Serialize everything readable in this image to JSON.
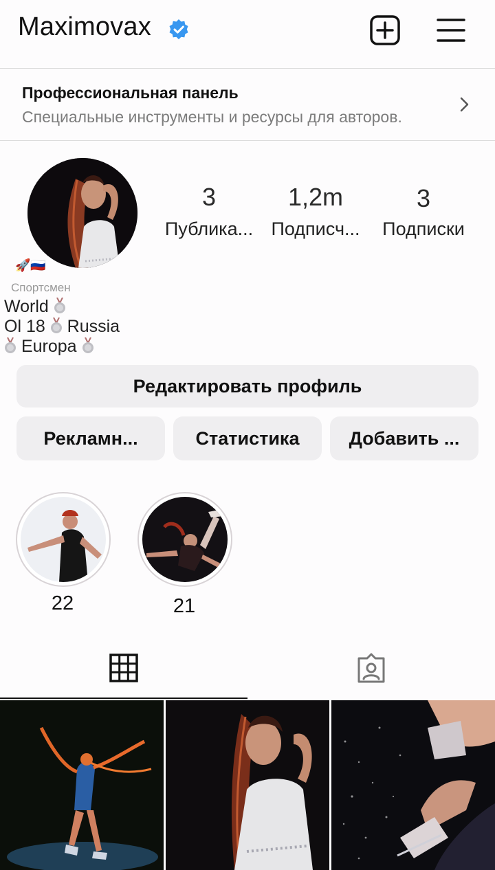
{
  "header": {
    "username": "Maximovax",
    "verified_icon": "verified-badge-icon",
    "new_post_icon": "plus-square-icon",
    "menu_icon": "hamburger-menu-icon"
  },
  "pro_panel": {
    "title": "Профессиональная панель",
    "subtitle": "Специальные инструменты и ресурсы для авторов."
  },
  "profile": {
    "stats": [
      {
        "value": "3",
        "label": "Публика..."
      },
      {
        "value": "1,2m",
        "label": "Подписч..."
      },
      {
        "value": "3",
        "label": "Подписки"
      }
    ],
    "emoji": "🚀🇷🇺",
    "category": "Спортсмен",
    "bio": {
      "line1": "World",
      "line2a": "Ol 18",
      "line2b": "Russia",
      "line3": "Europa"
    }
  },
  "buttons": {
    "edit_profile": "Редактировать профиль",
    "ads": "Рекламн...",
    "statistics": "Статистика",
    "add": "Добавить ..."
  },
  "highlights": [
    {
      "label": "22"
    },
    {
      "label": "21"
    }
  ],
  "tabs": {
    "grid_icon": "grid-icon",
    "tagged_icon": "tagged-person-icon"
  },
  "colors": {
    "verified_blue": "#3897f0",
    "button_bg": "#efeef0",
    "secondary_text": "#7c7c7c"
  }
}
